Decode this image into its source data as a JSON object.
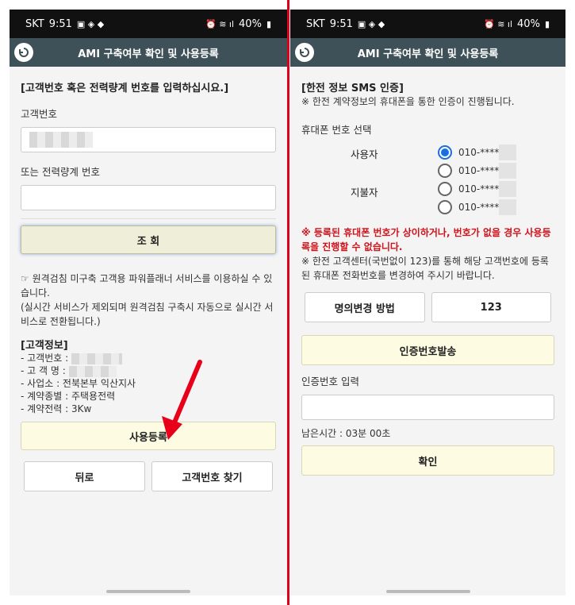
{
  "status_bar": {
    "carrier": "SKT",
    "time": "9:51",
    "battery": "40%"
  },
  "left": {
    "title": "AMI 구축여부 확인 및 사용등록",
    "instruction": "[고객번호 혹은 전력량계 번호를 입력하십시요.]",
    "customer_number_label": "고객번호",
    "meter_number_label": "또는 전력량계 번호",
    "search_button": "조 회",
    "notice": "☞ 원격검침 미구축 고객용 파워플래너 서비스를 이용하실 수 있습니다.",
    "notice2": "(실시간 서비스가 제외되며 원격검침 구축시 자동으로 실시간 서비스로 전환됩니다.)",
    "customer_info_title": "[고객정보]",
    "info": {
      "customer_no": "- 고객번호 :",
      "customer_name": "- 고 객 명 :",
      "office": "- 사업소 : 전북본부 익산지사",
      "contract_type": "- 계약종별 : 주택용전력",
      "contract_power": "- 계약전력 : 3Kw"
    },
    "register_button": "사용등록",
    "back_button": "뒤로",
    "find_button": "고객번호 찾기"
  },
  "right": {
    "title": "AMI 구축여부 확인 및 사용등록",
    "sms_title": "[한전 정보 SMS 인증]",
    "sms_note": "※ 한전 계약정보의 휴대폰을 통한 인증이 진행됩니다.",
    "phone_select_label": "휴대폰 번호 선택",
    "user_label": "사용자",
    "payer_label": "지불자",
    "phones": [
      "010-****",
      "010-****",
      "010-****",
      "010-****"
    ],
    "warning": "※ 등록된 휴대폰 번호가 상이하거나, 번호가 없을 경우 사용등록을 진행할 수 없습니다.",
    "center_note": "※ 한전 고객센터(국번없이 123)를 통해 해당 고객번호에 등록된 휴대폰 전화번호를 변경하여 주시기 바랍니다.",
    "name_change_button": "명의변경 방법",
    "call_button": "123",
    "send_code_button": "인증번호발송",
    "code_input_label": "인증번호 입력",
    "remaining_time": "남은시간 : 03분 00초",
    "confirm_button": "확인"
  },
  "colors": {
    "titlebar": "#3e5158",
    "accent_red": "#e0001e",
    "warning_text": "#d0121b",
    "button_bg": "#fdfbe2",
    "radio_selected": "#1a6fe0"
  }
}
